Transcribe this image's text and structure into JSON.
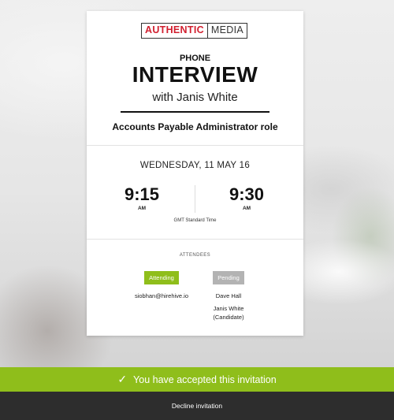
{
  "logo": {
    "part1": "AUTHENTIC",
    "part2": "MEDIA"
  },
  "interview": {
    "type": "PHONE",
    "title": "INTERVIEW",
    "with": "with Janis White",
    "role": "Accounts Payable Administrator role"
  },
  "schedule": {
    "date": "WEDNESDAY, 11 MAY 16",
    "start": {
      "time": "9:15",
      "ampm": "AM"
    },
    "end": {
      "time": "9:30",
      "ampm": "AM"
    },
    "timezone": "GMT Standard Time"
  },
  "attendees": {
    "heading": "ATTENDEES",
    "list": [
      {
        "status": "Attending",
        "name": "siobhan@hirehive.io"
      },
      {
        "status": "Pending",
        "name": "Dave Hall",
        "extra_line1": "Janis White",
        "extra_line2": "(Candidate)"
      }
    ]
  },
  "banner": {
    "accepted_text": "You have accepted this invitation",
    "decline_text": "Decline invitation"
  },
  "colors": {
    "accent_green": "#8fbe1b",
    "brand_red": "#d11f2f",
    "dark_bar": "#2d2d2d",
    "pending_gray": "#b3b3b3"
  }
}
